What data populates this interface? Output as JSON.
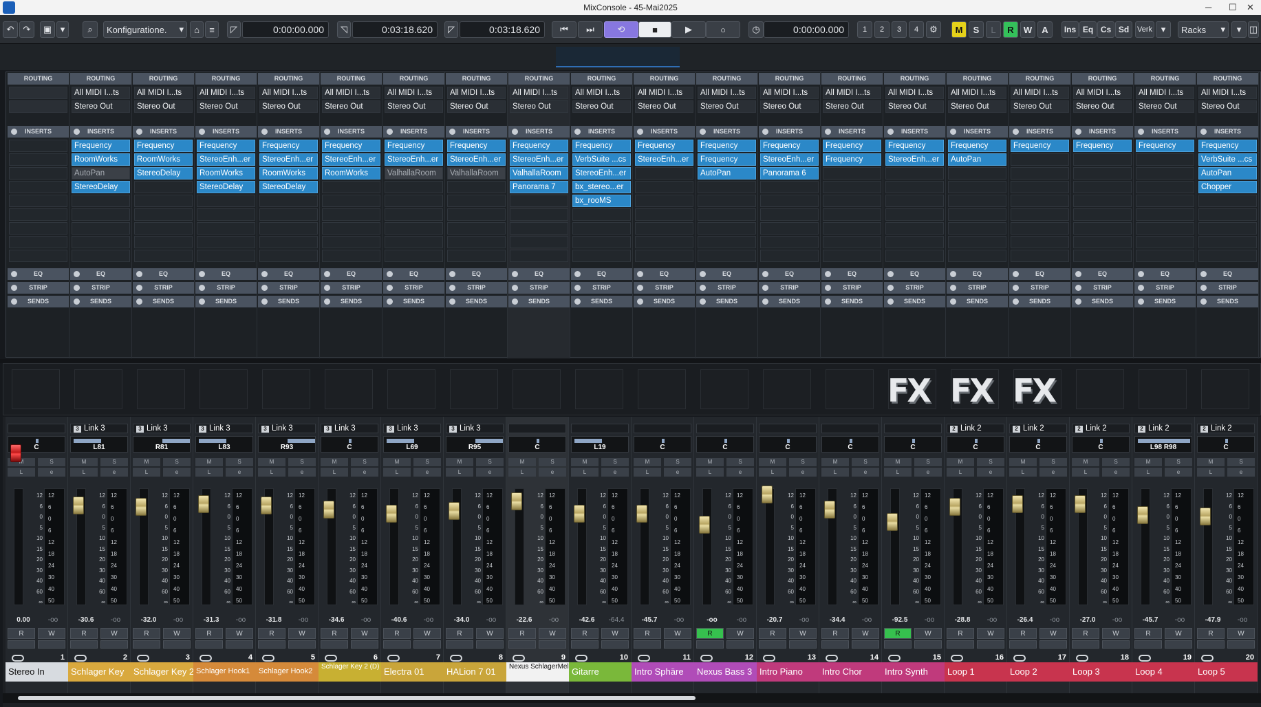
{
  "window": {
    "title": "MixConsole - 45-Mai2025"
  },
  "toolbar": {
    "config_label": "Konfiguratione.",
    "time_display": "0:00:00.000",
    "left_locator": "0:03:18.620",
    "right_locator": "0:03:18.620",
    "secondary_time": "0:00:00.000",
    "zones": [
      "1",
      "2",
      "3",
      "4"
    ],
    "m": "M",
    "s": "S",
    "l": "L",
    "r": "R",
    "w": "W",
    "a": "A",
    "ins": "Ins",
    "eq": "Eq",
    "cs": "Cs",
    "sd": "Sd",
    "verk": "Verk",
    "racks": "Racks"
  },
  "section_labels": {
    "routing": "ROUTING",
    "inserts": "INSERTS",
    "eq": "EQ",
    "strip": "STRIP",
    "sends": "SENDS"
  },
  "fx_label": "FX",
  "channels": [
    {
      "num": "1",
      "name": "Stereo In",
      "color": "#d7dbe0",
      "text": "#111",
      "routing": [
        "",
        ""
      ],
      "inserts": [
        "",
        "",
        "",
        ""
      ],
      "link": "",
      "pan": "C",
      "vol": "0.00",
      "peak": "-oo"
    },
    {
      "num": "2",
      "name": "Schlager Key",
      "color": "#d9a93e",
      "routing": [
        "All MIDI I...ts",
        "Stereo Out"
      ],
      "inserts": [
        "Frequency",
        "RoomWorks",
        "AutoPan",
        "StereoDelay"
      ],
      "link": "Link 3",
      "pan": "L81",
      "vol": "-30.6",
      "peak": "-oo"
    },
    {
      "num": "3",
      "name": "Schlager Key 2",
      "color": "#d9a93e",
      "routing": [
        "All MIDI I...ts",
        "Stereo Out"
      ],
      "inserts": [
        "Frequency",
        "RoomWorks",
        "StereoDelay",
        ""
      ],
      "link": "Link 3",
      "pan": "R81",
      "vol": "-32.0",
      "peak": "-oo"
    },
    {
      "num": "4",
      "name": "Schlager Hook1",
      "color": "#d58a3a",
      "routing": [
        "All MIDI I...ts",
        "Stereo Out"
      ],
      "inserts": [
        "Frequency",
        "StereoEnh...er",
        "RoomWorks",
        "StereoDelay"
      ],
      "link": "Link 3",
      "pan": "L83",
      "vol": "-31.3",
      "peak": "-oo"
    },
    {
      "num": "5",
      "name": "Schlager Hook2",
      "color": "#d58a3a",
      "routing": [
        "All MIDI I...ts",
        "Stereo Out"
      ],
      "inserts": [
        "Frequency",
        "StereoEnh...er",
        "RoomWorks",
        "StereoDelay"
      ],
      "link": "Link 3",
      "pan": "R93",
      "vol": "-31.8",
      "peak": "-oo"
    },
    {
      "num": "6",
      "name": "Schlager Key 2 (D)",
      "color": "#c8b032",
      "routing": [
        "All MIDI I...ts",
        "Stereo Out"
      ],
      "inserts": [
        "Frequency",
        "StereoEnh...er",
        "RoomWorks",
        ""
      ],
      "link": "Link 3",
      "pan": "C",
      "vol": "-34.6",
      "peak": "-oo"
    },
    {
      "num": "7",
      "name": "Electra 01",
      "color": "#c9a53a",
      "routing": [
        "All MIDI I...ts",
        "Stereo Out"
      ],
      "inserts": [
        "Frequency",
        "StereoEnh...er",
        "ValhallaRoom",
        ""
      ],
      "link": "Link 3",
      "pan": "L69",
      "vol": "-40.6",
      "peak": "-oo"
    },
    {
      "num": "8",
      "name": "HALion 7 01",
      "color": "#c9a53a",
      "routing": [
        "All MIDI I...ts",
        "Stereo Out"
      ],
      "inserts": [
        "Frequency",
        "StereoEnh...er",
        "ValhallaRoom",
        ""
      ],
      "link": "Link 3",
      "pan": "R95",
      "vol": "-34.0",
      "peak": "-oo"
    },
    {
      "num": "9",
      "name": "Nexus SchlagerMelo",
      "color": "#f2f2f2",
      "text": "#111",
      "routing": [
        "All MIDI I...ts",
        "Stereo Out"
      ],
      "inserts": [
        "Frequency",
        "StereoEnh...er",
        "ValhallaRoom",
        "Panorama 7"
      ],
      "link": "",
      "pan": "C",
      "vol": "-22.6",
      "peak": "-oo"
    },
    {
      "num": "10",
      "name": "Gitarre",
      "color": "#7ab83a",
      "routing": [
        "All MIDI I...ts",
        "Stereo Out"
      ],
      "inserts": [
        "Frequency",
        "VerbSuite ...cs",
        "StereoEnh...er",
        "bx_stereo...er",
        "bx_rooMS"
      ],
      "link": "",
      "pan": "L19",
      "vol": "-42.6",
      "peak": "-64.4"
    },
    {
      "num": "11",
      "name": "Intro Sphäre",
      "color": "#b04cb8",
      "routing": [
        "All MIDI I...ts",
        "Stereo Out"
      ],
      "inserts": [
        "Frequency",
        "StereoEnh...er",
        "",
        ""
      ],
      "link": "",
      "pan": "C",
      "vol": "-45.7",
      "peak": "-oo"
    },
    {
      "num": "12",
      "name": "Nexus Bass 3",
      "color": "#b04cb8",
      "routing": [
        "All MIDI I...ts",
        "Stereo Out"
      ],
      "inserts": [
        "Frequency",
        "Frequency",
        "AutoPan",
        ""
      ],
      "link": "",
      "pan": "C",
      "vol": "-oo",
      "peak": "-oo"
    },
    {
      "num": "13",
      "name": "Intro Piano",
      "color": "#c03a7c",
      "routing": [
        "All MIDI I...ts",
        "Stereo Out"
      ],
      "inserts": [
        "Frequency",
        "StereoEnh...er",
        "Panorama 6",
        ""
      ],
      "link": "",
      "pan": "C",
      "vol": "-20.7",
      "peak": "-oo"
    },
    {
      "num": "14",
      "name": "Intro Chor",
      "color": "#c03a7c",
      "routing": [
        "All MIDI I...ts",
        "Stereo Out"
      ],
      "inserts": [
        "Frequency",
        "Frequency",
        "",
        ""
      ],
      "link": "",
      "pan": "C",
      "vol": "-34.4",
      "peak": "-oo"
    },
    {
      "num": "15",
      "name": "Intro Synth",
      "color": "#c03a7c",
      "routing": [
        "All MIDI I...ts",
        "Stereo Out"
      ],
      "inserts": [
        "Frequency",
        "StereoEnh...er",
        "",
        ""
      ],
      "link": "",
      "pan": "C",
      "vol": "-92.5",
      "peak": "-oo"
    },
    {
      "num": "16",
      "name": "Loop 1",
      "color": "#c8344e",
      "routing": [
        "All MIDI I...ts",
        "Stereo Out"
      ],
      "inserts": [
        "Frequency",
        "AutoPan",
        "",
        ""
      ],
      "link": "Link 2",
      "pan": "C",
      "vol": "-28.8",
      "peak": "-oo"
    },
    {
      "num": "17",
      "name": "Loop 2",
      "color": "#c8344e",
      "routing": [
        "All MIDI I...ts",
        "Stereo Out"
      ],
      "inserts": [
        "Frequency",
        "",
        "",
        ""
      ],
      "link": "Link 2",
      "pan": "C",
      "vol": "-26.4",
      "peak": "-oo"
    },
    {
      "num": "18",
      "name": "Loop 3",
      "color": "#c8344e",
      "routing": [
        "All MIDI I...ts",
        "Stereo Out"
      ],
      "inserts": [
        "Frequency",
        "",
        "",
        ""
      ],
      "link": "Link 2",
      "pan": "C",
      "vol": "-27.0",
      "peak": "-oo"
    },
    {
      "num": "19",
      "name": "Loop 4",
      "color": "#c8344e",
      "routing": [
        "All MIDI I...ts",
        "Stereo Out"
      ],
      "inserts": [
        "Frequency",
        "",
        "",
        ""
      ],
      "link": "Link 2",
      "pan": "L98 R98",
      "vol": "-45.7",
      "peak": "-oo"
    },
    {
      "num": "20",
      "name": "Loop 5",
      "color": "#c8344e",
      "routing": [
        "All MIDI I...ts",
        "Stereo Out"
      ],
      "inserts": [
        "Frequency",
        "VerbSuite ...cs",
        "AutoPan",
        "Chopper"
      ],
      "link": "Link 2",
      "pan": "C",
      "vol": "-47.9",
      "peak": "-oo"
    }
  ],
  "fader_scale": [
    "12",
    "6",
    "0",
    "5",
    "10",
    "15",
    "20",
    "30",
    "40",
    "60",
    "∞"
  ],
  "meter_scale": [
    "12",
    "6",
    "0",
    "6",
    "12",
    "18",
    "24",
    "30",
    "40",
    "50"
  ]
}
